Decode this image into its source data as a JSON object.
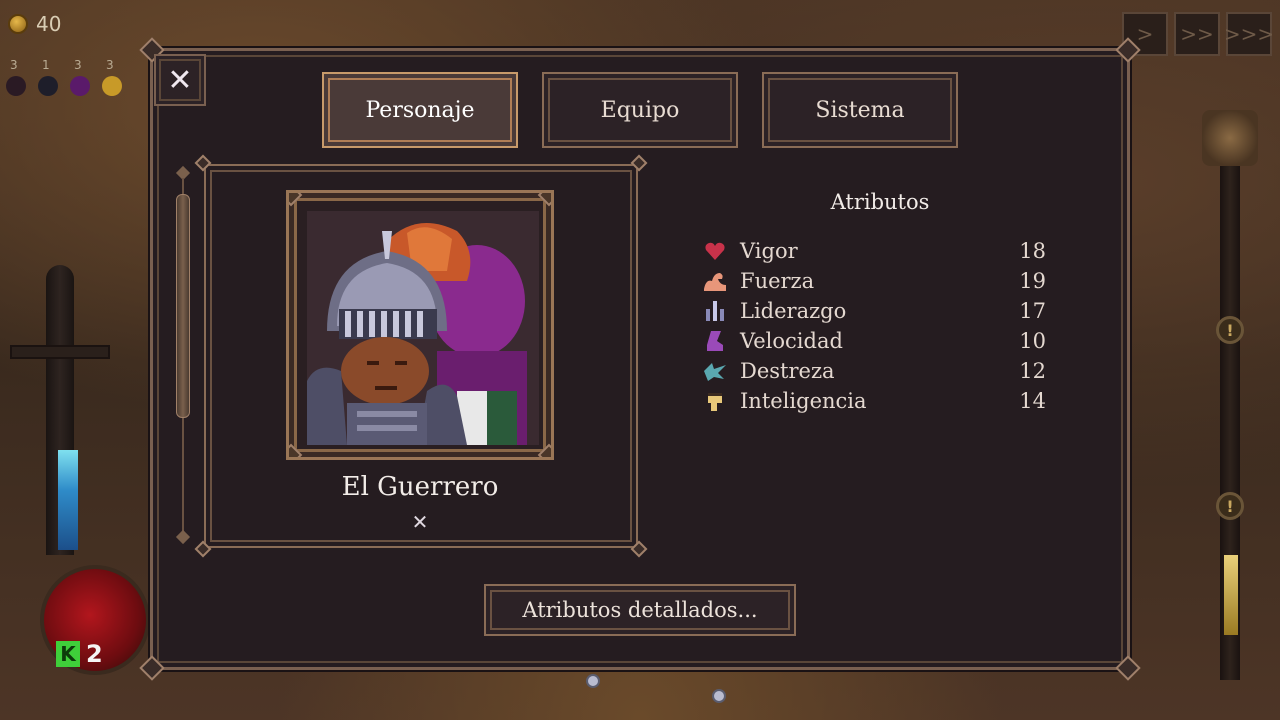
{
  "hud": {
    "coins": "40",
    "status_counts": [
      "3",
      "1",
      "3",
      "3"
    ],
    "kills": "2",
    "speed_icons": [
      ">",
      ">>",
      ">>>"
    ]
  },
  "menu": {
    "close_glyph": "✕",
    "tabs": [
      {
        "label": "Personaje",
        "active": true
      },
      {
        "label": "Equipo",
        "active": false
      },
      {
        "label": "Sistema",
        "active": false
      }
    ],
    "character": {
      "name": "El Guerrero",
      "remove_glyph": "✕"
    },
    "attributes": {
      "title": "Atributos",
      "items": [
        {
          "icon": "heart-icon",
          "label": "Vigor",
          "value": "18",
          "color": "#c8324a"
        },
        {
          "icon": "arm-icon",
          "label": "Fuerza",
          "value": "19",
          "color": "#e8967a"
        },
        {
          "icon": "leadership-icon",
          "label": "Liderazgo",
          "value": "17",
          "color": "#8a8ab8"
        },
        {
          "icon": "boot-icon",
          "label": "Velocidad",
          "value": "10",
          "color": "#9a4ab8"
        },
        {
          "icon": "dexterity-icon",
          "label": "Destreza",
          "value": "12",
          "color": "#5aa8b0"
        },
        {
          "icon": "head-icon",
          "label": "Inteligencia",
          "value": "14",
          "color": "#e8c87a"
        }
      ]
    },
    "detail_button": "Atributos detallados..."
  },
  "colors": {
    "panel_bg": "#251c20",
    "frame_border": "#8a6c56",
    "active_tab": "#4a3a38",
    "text": "#e8dcd2"
  }
}
